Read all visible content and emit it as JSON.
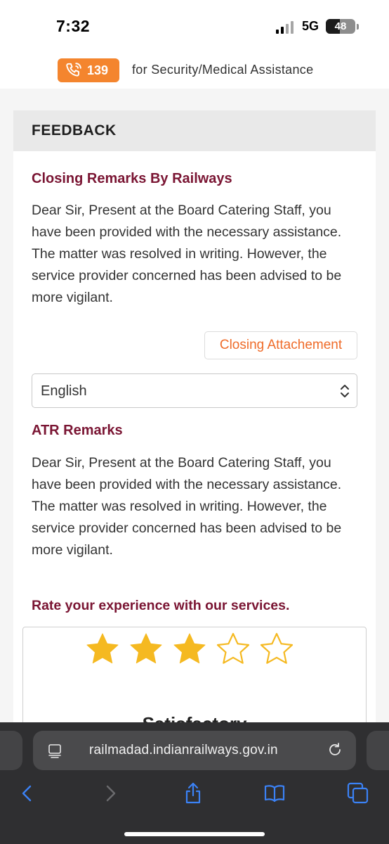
{
  "status_bar": {
    "time": "7:32",
    "network": "5G",
    "battery": "48",
    "battery_level_percent": 48
  },
  "helpline": {
    "number": "139",
    "text": "for Security/Medical Assistance",
    "icon": "phone-icon",
    "accent": "#f4852e"
  },
  "feedback": {
    "title": "FEEDBACK",
    "closing_remarks": {
      "heading": "Closing Remarks By Railways",
      "text": "Dear Sir, Present at the Board Catering Staff, you have been provided with the necessary assistance. The matter was resolved in writing. However, the service provider concerned has been advised to be more vigilant."
    },
    "closing_attachment_label": "Closing Attachement",
    "language_select": {
      "value": "English",
      "icon": "updown-chevron-icon"
    },
    "atr_remarks": {
      "heading": "ATR Remarks",
      "text": "Dear Sir, Present at the Board Catering Staff, you have been provided with the necessary assistance. The matter was resolved in writing. However, the service provider concerned has been advised to be more vigilant."
    },
    "rating": {
      "prompt": "Rate your experience with our services.",
      "value": 3,
      "max": 5,
      "label": "Satisfactory",
      "star_color": "#f5b921"
    }
  },
  "browser": {
    "url": "railmadad.indianrailways.gov.in",
    "toolbar_icons": [
      "back-icon",
      "forward-icon",
      "share-icon",
      "bookmarks-icon",
      "tabs-icon"
    ]
  },
  "colors": {
    "heading": "#7a1533",
    "link_orange": "#ef6c2a",
    "ios_blue": "#3b82f6"
  }
}
